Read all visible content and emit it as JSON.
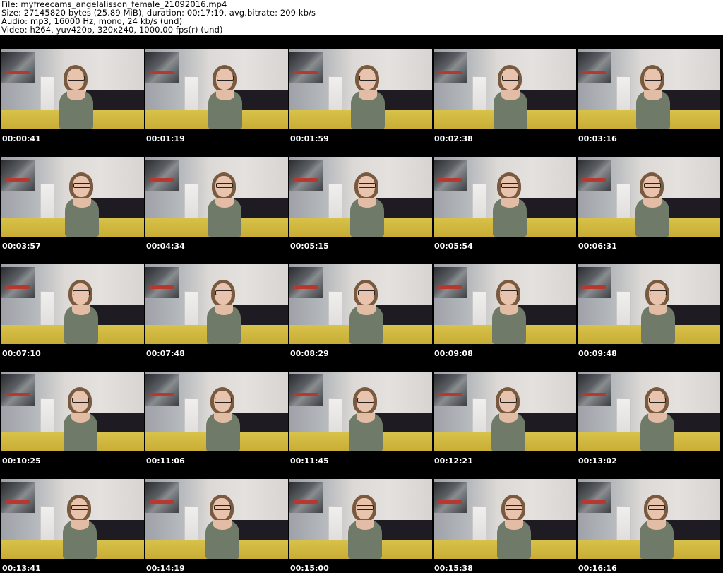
{
  "header": {
    "file": "File: myfreecams_angelalisson_female_21092016.mp4",
    "size": "Size: 27145820 bytes (25.89 MiB), duration: 00:17:19, avg.bitrate: 209 kb/s",
    "audio": "Audio: mp3, 16000 Hz, mono, 24 kb/s (und)",
    "video": "Video: h264, yuv420p, 320x240, 1000.00 fps(r) (und)"
  },
  "timestamps": [
    "00:00:41",
    "00:01:19",
    "00:01:59",
    "00:02:38",
    "00:03:16",
    "00:03:57",
    "00:04:34",
    "00:05:15",
    "00:05:54",
    "00:06:31",
    "00:07:10",
    "00:07:48",
    "00:08:29",
    "00:09:08",
    "00:09:48",
    "00:10:25",
    "00:11:06",
    "00:11:45",
    "00:12:21",
    "00:13:02",
    "00:13:41",
    "00:14:19",
    "00:15:00",
    "00:15:38",
    "00:16:16"
  ],
  "colors": {
    "background": "#ffffff",
    "grid_background": "#000000",
    "timestamp_text": "#ffffff"
  }
}
